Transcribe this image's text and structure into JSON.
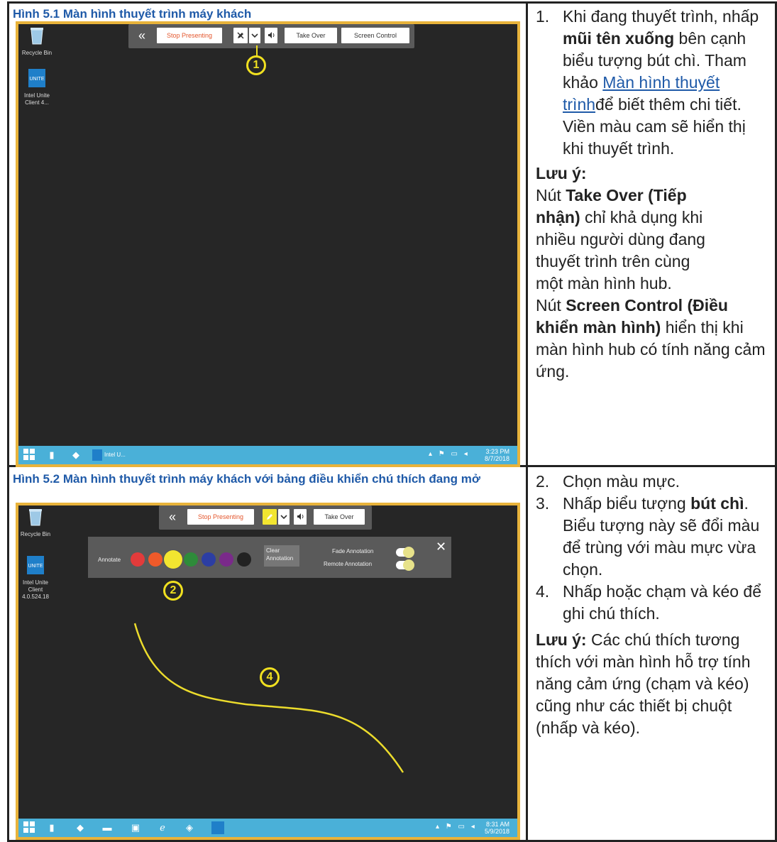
{
  "figure1": {
    "caption": "Hình 5.1 Màn hình thuyết trình máy khách",
    "desktop_icons": [
      {
        "label": "Recycle Bin",
        "icon": "recycle-bin-icon"
      },
      {
        "label": "Intel Unite Client 4...",
        "icon": "intel-unite-icon"
      }
    ],
    "toolbar": {
      "collapse_glyph": "«",
      "stop_label": "Stop Presenting",
      "pencil_icon": "pencil-icon",
      "dropdown_icon": "chevron-down-icon",
      "speaker_icon": "speaker-icon",
      "take_over_label": "Take Over",
      "screen_control_label": "Screen Control"
    },
    "callout": "1",
    "taskbar": {
      "app_label": "Intel U...",
      "time": "3:23 PM",
      "date": "8/7/2018"
    }
  },
  "figure2": {
    "caption": "Hình 5.2 Màn hình thuyết trình máy khách với bảng điều khiển chú thích đang mở",
    "desktop_icons": [
      {
        "label": "Recycle Bin",
        "icon": "recycle-bin-icon"
      },
      {
        "label": "Intel Unite Client 4.0.524.18",
        "icon": "intel-unite-icon"
      }
    ],
    "toolbar": {
      "collapse_glyph": "«",
      "stop_label": "Stop Presenting",
      "take_over_label": "Take Over"
    },
    "annotation_panel": {
      "annotate_label": "Annotate",
      "colors": [
        "#e23b3b",
        "#ef5a2a",
        "#f2e530",
        "#2e8b3a",
        "#2c3ea3",
        "#7a2a8a",
        "#222222"
      ],
      "clear_label": "Clear Annotation",
      "fade_label": "Fade Annotation",
      "remote_label": "Remote Annotation",
      "close_glyph": "✕"
    },
    "callout_2": "2",
    "callout_4": "4",
    "taskbar": {
      "time": "8:31 AM",
      "date": "5/9/2018"
    }
  },
  "text1": {
    "step_num": "1.",
    "step_a": "Khi đang thuyết trình, nhấp ",
    "step_bold": "mũi tên xuống",
    "step_b": " bên cạnh biểu tượng bút chì. Tham khảo ",
    "step_link": " Màn hình thuyết trình",
    "step_c": "để biết thêm chi tiết. Viền màu cam sẽ hiển thị khi thuyết trình.",
    "note_title": "Lưu ý:",
    "note1_a": "Nút ",
    "note1_bold": "Take Over (Tiếp nhận)",
    "note1_b": " chỉ khả dụng khi nhiều người dùng đang thuyết trình trên cùng một màn hình hub.",
    "note2_a": "Nút ",
    "note2_bold": "Screen Control (Điều khiển màn hình)",
    "note2_b": " hiển thị khi màn hình hub có tính năng cảm ứng."
  },
  "text2": {
    "s2_num": "2.",
    "s2": "Chọn màu mực.",
    "s3_num": "3.",
    "s3_a": "Nhấp biểu tượng ",
    "s3_bold": "bút chì",
    "s3_b": ". Biểu tượng này sẽ đổi màu để trùng với màu mực vừa chọn.",
    "s4_num": "4.",
    "s4": "Nhấp hoặc chạm và kéo để ghi chú thích.",
    "note_title": "Lưu ý:",
    "note": " Các chú thích tương thích với màn hình hỗ trợ tính năng cảm ứng (chạm và kéo) cũng như các thiết bị chuột (nhấp và kéo)."
  }
}
